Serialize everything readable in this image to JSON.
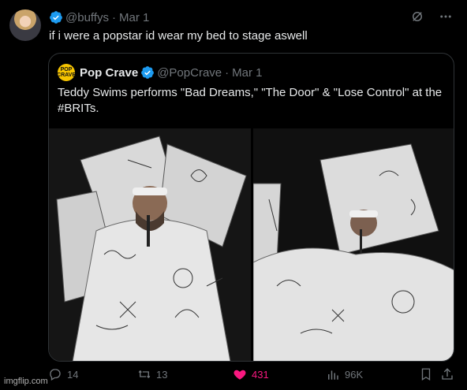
{
  "tweet": {
    "handle": "@buffys",
    "separator": "·",
    "date": "Mar 1",
    "text": "if i were a popstar id wear my bed to stage aswell"
  },
  "quote": {
    "avatar_text": "POP CRAVE",
    "name": "Pop Crave",
    "handle": "@PopCrave",
    "separator": "·",
    "date": "Mar 1",
    "text": "Teddy Swims performs \"Bad Dreams,\" \"The Door\" & \"Lose Control\" at the #BRITs."
  },
  "actions": {
    "replies": "14",
    "reposts": "13",
    "likes": "431",
    "views": "96K"
  },
  "watermark": "imgflip.com",
  "colors": {
    "background": "#000000",
    "text": "#e7e9ea",
    "muted": "#71767b",
    "verified": "#1d9bf0",
    "like": "#f91880",
    "border": "#2f3336"
  }
}
